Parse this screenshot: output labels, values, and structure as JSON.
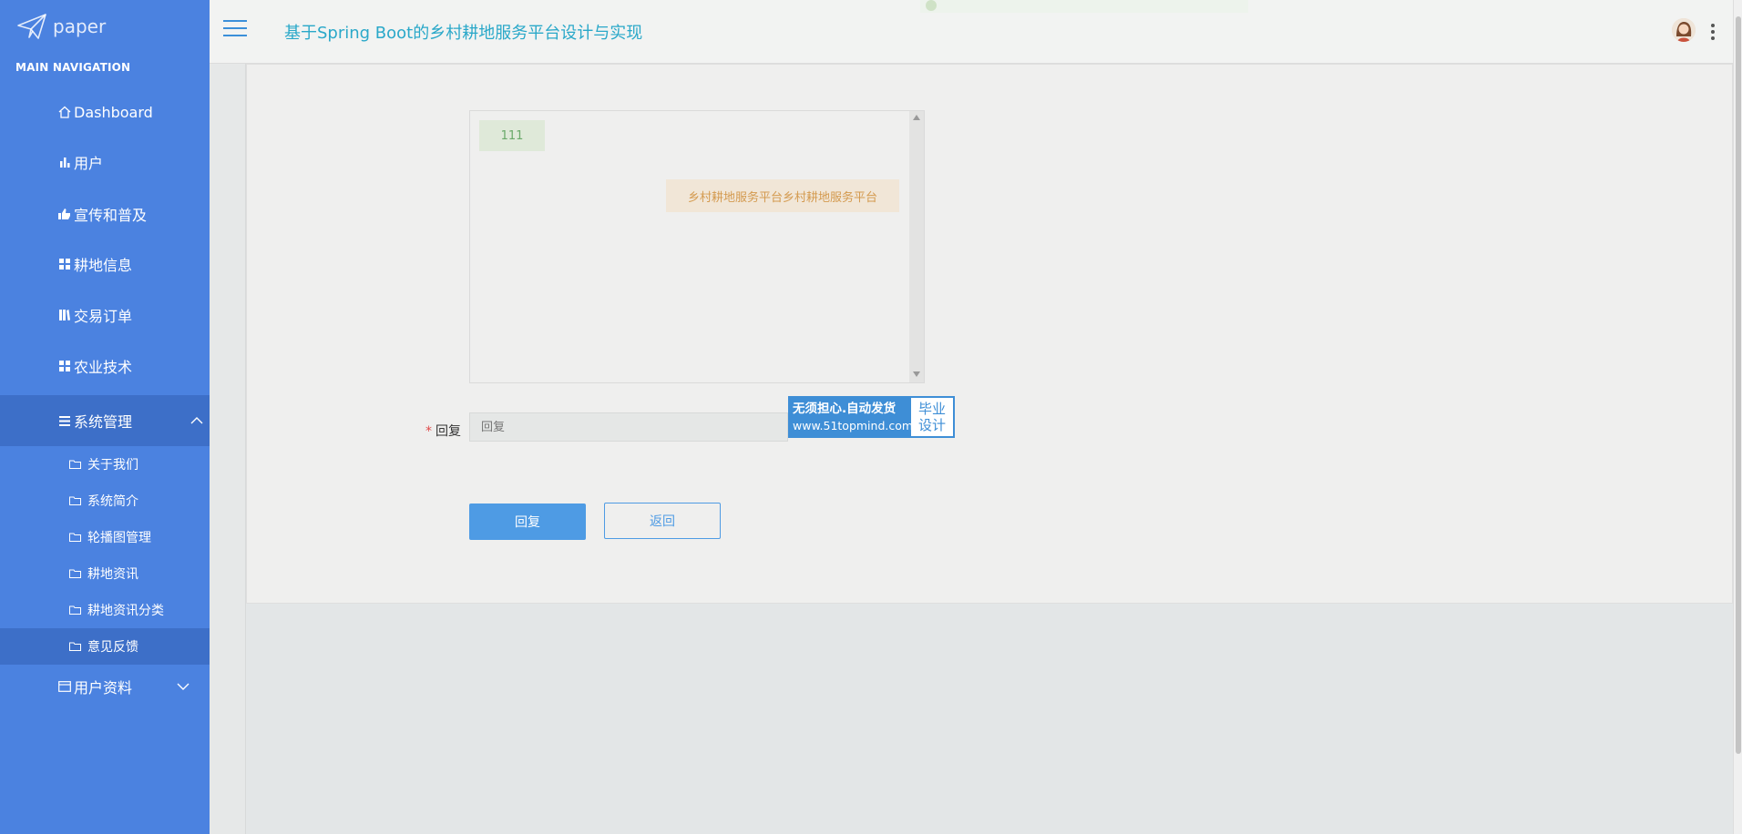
{
  "brand": {
    "name": "paper"
  },
  "nav": {
    "header": "MAIN NAVIGATION",
    "items": [
      {
        "label": "Dashboard",
        "icon": "home-icon"
      },
      {
        "label": "用户",
        "icon": "bar-chart-icon"
      },
      {
        "label": "宣传和普及",
        "icon": "thumbs-icon"
      },
      {
        "label": "耕地信息",
        "icon": "grid-icon"
      },
      {
        "label": "交易订单",
        "icon": "book-icon"
      },
      {
        "label": "农业技术",
        "icon": "grid-icon"
      },
      {
        "label": "系统管理",
        "icon": "list-icon",
        "expanded": true
      },
      {
        "label": "用户资料",
        "icon": "card-icon",
        "expanded": false
      }
    ],
    "sub_items": [
      {
        "label": "关于我们"
      },
      {
        "label": "系统简介"
      },
      {
        "label": "轮播图管理"
      },
      {
        "label": "耕地资讯"
      },
      {
        "label": "耕地资讯分类"
      },
      {
        "label": "意见反馈",
        "active": true
      }
    ]
  },
  "header": {
    "title": "基于Spring Boot的乡村耕地服务平台设计与实现"
  },
  "chat": {
    "messages": [
      {
        "side": "left",
        "text": "111"
      },
      {
        "side": "right",
        "text": "乡村耕地服务平台乡村耕地服务平台"
      }
    ]
  },
  "form": {
    "reply_label": "回复",
    "required_mark": "*",
    "reply_placeholder": "回复",
    "reply_value": ""
  },
  "promo": {
    "line1": "无须担心.自动发货",
    "line2": "www.51topmind.com",
    "right_line1": "毕业",
    "right_line2": "设计"
  },
  "buttons": {
    "reply": "回复",
    "back": "返回"
  },
  "colors": {
    "sidebar": "#4b82e0",
    "sidebar_active": "#3d6fc8",
    "title": "#2aa8c9",
    "primary": "#4e9be4"
  }
}
